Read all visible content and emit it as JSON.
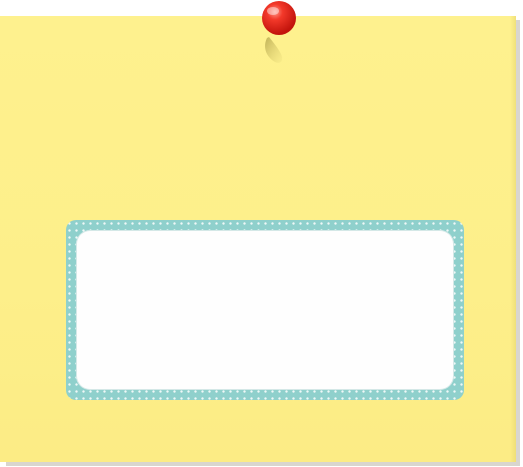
{
  "note": {
    "paper_color": "#fef18e",
    "frame_color": "#8fd0cc",
    "label_fill": "#fefefe",
    "label_text": ""
  },
  "pin": {
    "icon": "pushpin-icon",
    "color": "#e8231a"
  }
}
